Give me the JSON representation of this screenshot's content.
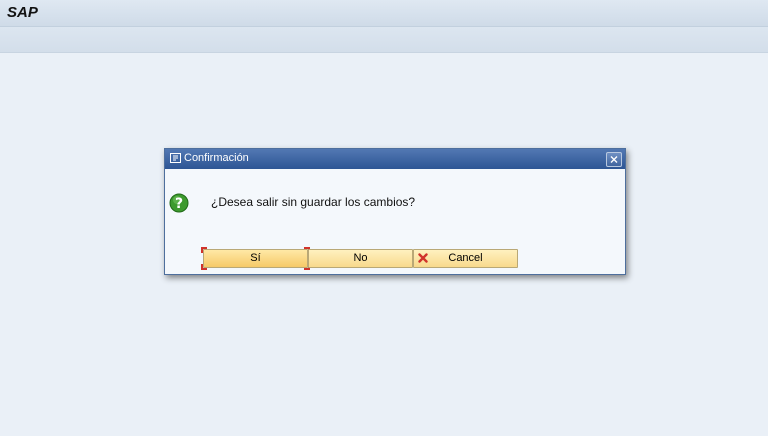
{
  "app": {
    "title": "SAP"
  },
  "dialog": {
    "title": "Confirmación",
    "message": "¿Desea salir sin guardar los cambios?",
    "icon": "question-icon",
    "buttons": {
      "yes_label": "Sí",
      "no_label": "No",
      "cancel_label": "Cancel"
    }
  },
  "colors": {
    "header": "#2d5594",
    "button": "#f8d98c",
    "focus": "#d0332b",
    "background": "#eaf0f7"
  }
}
